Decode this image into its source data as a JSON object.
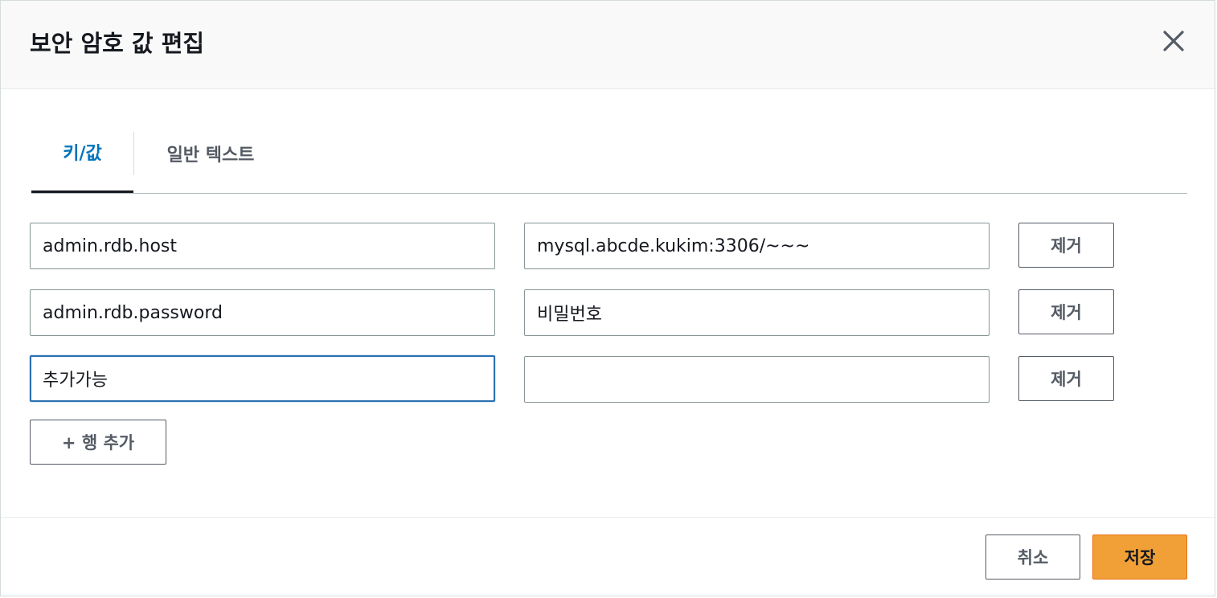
{
  "modal": {
    "title": "보안 암호 값 편집",
    "close_icon": "close-icon"
  },
  "tabs": [
    {
      "label": "키/값",
      "active": true
    },
    {
      "label": "일반 텍스트",
      "active": false
    }
  ],
  "rows": [
    {
      "key": "admin.rdb.host",
      "value": "mysql.abcde.kukim:3306/~~~",
      "remove_label": "제거"
    },
    {
      "key": "admin.rdb.password",
      "value": "비밀번호",
      "remove_label": "제거"
    },
    {
      "key": "추가가능",
      "value": "",
      "remove_label": "제거"
    }
  ],
  "add_row_label": "+ 행 추가",
  "footer": {
    "cancel_label": "취소",
    "save_label": "저장"
  },
  "colors": {
    "accent_tab": "#0073bb",
    "primary_button": "#f0a037",
    "focus_border": "#2c6fb3"
  }
}
